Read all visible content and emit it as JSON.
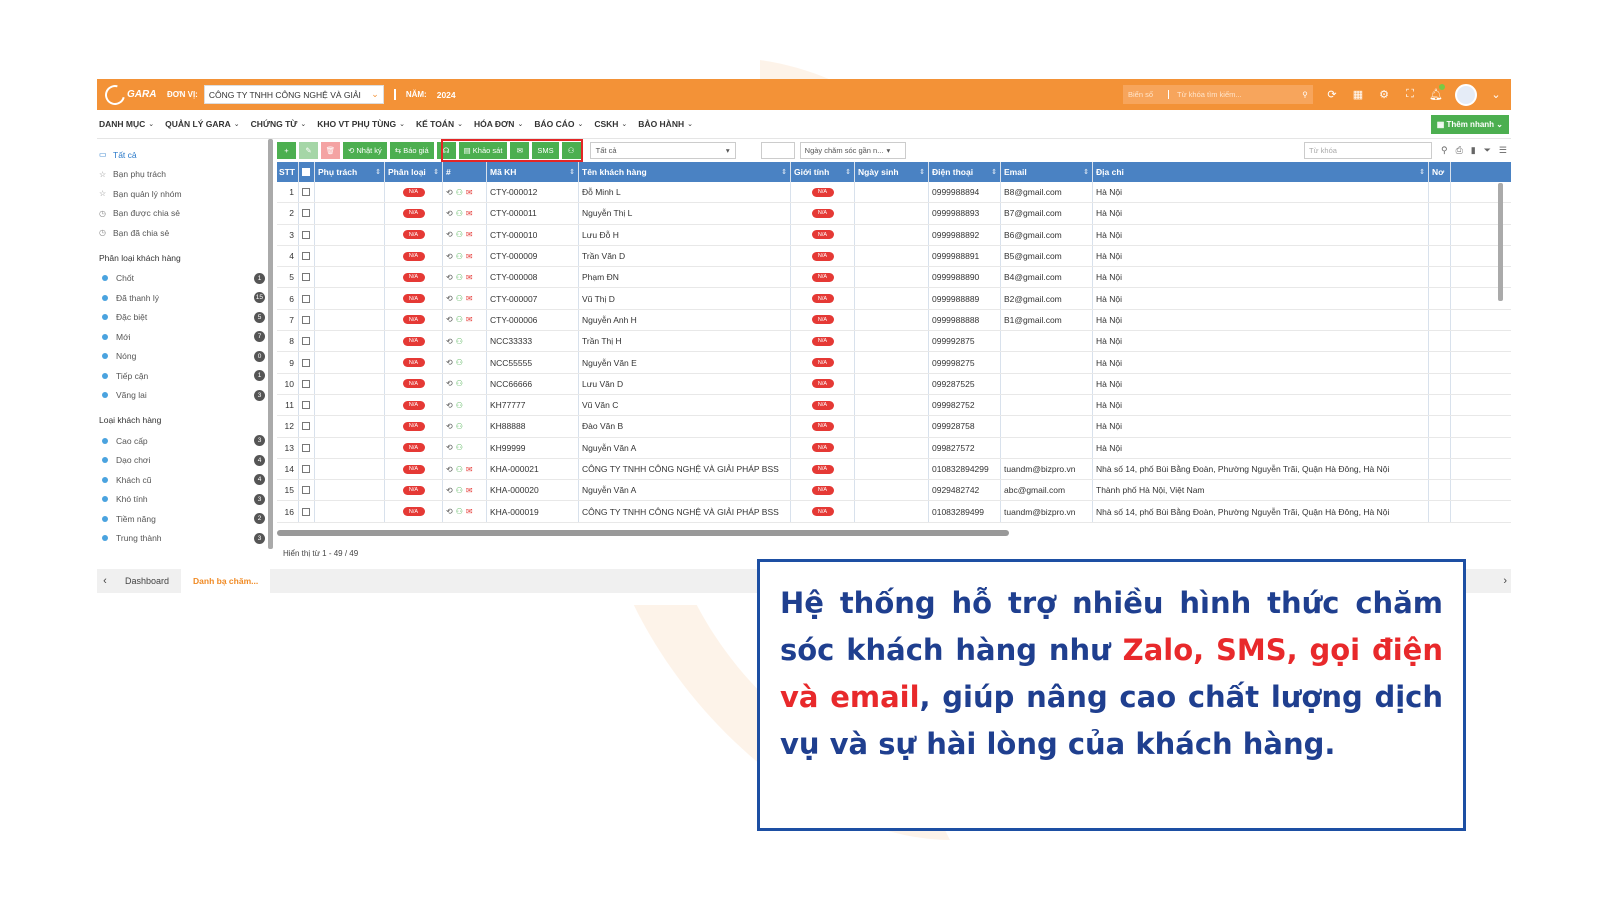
{
  "app": {
    "logo_text": "GARA",
    "unit_label": "ĐƠN VỊ:",
    "unit_value": "CÔNG TY TNHH CÔNG NGHỆ VÀ GIẢI",
    "year_label": "NĂM:",
    "year_value": "2024",
    "search_plate": "Biển số",
    "search_placeholder": "Từ khóa tìm kiếm...",
    "accent": "#f39237"
  },
  "menu": {
    "items": [
      "DANH MỤC",
      "QUẢN LÝ GARA",
      "CHỨNG TỪ",
      "KHO VT PHỤ TÙNG",
      "KẾ TOÁN",
      "HÓA ĐƠN",
      "BÁO CÁO",
      "CSKH",
      "BẢO HÀNH"
    ],
    "quick_add": "Thêm nhanh"
  },
  "sidebar": {
    "top": [
      {
        "label": "Tất cả",
        "icon": "inbox-icon"
      },
      {
        "label": "Bạn phụ trách",
        "icon": "star-icon"
      },
      {
        "label": "Bạn quản lý nhóm",
        "icon": "star-icon"
      },
      {
        "label": "Bạn được chia sẻ",
        "icon": "clock-icon"
      },
      {
        "label": "Bạn đã chia sẻ",
        "icon": "clock-icon"
      }
    ],
    "group1_title": "Phân loại khách hàng",
    "group1": [
      {
        "label": "Chốt",
        "count": "1"
      },
      {
        "label": "Đã thanh lý",
        "count": "15"
      },
      {
        "label": "Đặc biệt",
        "count": "5"
      },
      {
        "label": "Mới",
        "count": "7"
      },
      {
        "label": "Nóng",
        "count": "0"
      },
      {
        "label": "Tiếp cận",
        "count": "1"
      },
      {
        "label": "Vãng lai",
        "count": "3"
      }
    ],
    "group2_title": "Loại khách hàng",
    "group2": [
      {
        "label": "Cao cấp",
        "count": "3"
      },
      {
        "label": "Dạo chơi",
        "count": "4"
      },
      {
        "label": "Khách cũ",
        "count": "4"
      },
      {
        "label": "Khó tính",
        "count": "3"
      },
      {
        "label": "Tiềm năng",
        "count": "2"
      },
      {
        "label": "Trung thành",
        "count": "3"
      }
    ]
  },
  "toolbar": {
    "diary": "Nhật ký",
    "quote": "Báo giá",
    "survey": "Khảo sát",
    "sms": "SMS",
    "filter_all": "Tất cả",
    "date_filter": "Ngày chăm sóc gần n...",
    "keyword_placeholder": "Từ khóa"
  },
  "table": {
    "headers": [
      "STT",
      "Phụ trách",
      "Phân loại",
      "#",
      "Mã KH",
      "Tên khách hàng",
      "Giới tính",
      "Ngày sinh",
      "Điện thoại",
      "Email",
      "Địa chỉ",
      "Nơ"
    ],
    "na": "N/A",
    "rows": [
      {
        "stt": "1",
        "ma": "CTY-000012",
        "ten": "Đỗ Minh L",
        "dt": "0999988894",
        "email": "B8@gmail.com",
        "dc": "Hà Nội",
        "mail": true
      },
      {
        "stt": "2",
        "ma": "CTY-000011",
        "ten": "Nguyễn Thị L",
        "dt": "0999988893",
        "email": "B7@gmail.com",
        "dc": "Hà Nội",
        "mail": true
      },
      {
        "stt": "3",
        "ma": "CTY-000010",
        "ten": "Lưu Đỗ H",
        "dt": "0999988892",
        "email": "B6@gmail.com",
        "dc": "Hà Nội",
        "mail": true
      },
      {
        "stt": "4",
        "ma": "CTY-000009",
        "ten": "Trần Văn D",
        "dt": "0999988891",
        "email": "B5@gmail.com",
        "dc": "Hà Nội",
        "mail": true
      },
      {
        "stt": "5",
        "ma": "CTY-000008",
        "ten": "Phạm ĐN",
        "dt": "0999988890",
        "email": "B4@gmail.com",
        "dc": "Hà Nội",
        "mail": true
      },
      {
        "stt": "6",
        "ma": "CTY-000007",
        "ten": "Vũ Thị D",
        "dt": "0999988889",
        "email": "B2@gmail.com",
        "dc": "Hà Nội",
        "mail": true
      },
      {
        "stt": "7",
        "ma": "CTY-000006",
        "ten": "Nguyễn Anh H",
        "dt": "0999988888",
        "email": "B1@gmail.com",
        "dc": "Hà Nội",
        "mail": true
      },
      {
        "stt": "8",
        "ma": "NCC33333",
        "ten": "Trần Thị H",
        "dt": "099992875",
        "email": "",
        "dc": "Hà Nội",
        "mail": false
      },
      {
        "stt": "9",
        "ma": "NCC55555",
        "ten": "Nguyễn Văn E",
        "dt": "099998275",
        "email": "",
        "dc": "Hà Nội",
        "mail": false
      },
      {
        "stt": "10",
        "ma": "NCC66666",
        "ten": "Lưu Văn D",
        "dt": "099287525",
        "email": "",
        "dc": "Hà Nội",
        "mail": false
      },
      {
        "stt": "11",
        "ma": "KH77777",
        "ten": "Vũ Văn C",
        "dt": "099982752",
        "email": "",
        "dc": "Hà Nội",
        "mail": false
      },
      {
        "stt": "12",
        "ma": "KH88888",
        "ten": "Đào Văn B",
        "dt": "099928758",
        "email": "",
        "dc": "Hà Nội",
        "mail": false
      },
      {
        "stt": "13",
        "ma": "KH99999",
        "ten": "Nguyễn Văn A",
        "dt": "099827572",
        "email": "",
        "dc": "Hà Nội",
        "mail": false
      },
      {
        "stt": "14",
        "ma": "KHA-000021",
        "ten": "CÔNG TY TNHH CÔNG NGHỆ VÀ GIẢI PHÁP BSS",
        "dt": "010832894299",
        "email": "tuandm@bizpro.vn",
        "dc": "Nhà số 14, phố Bùi Bằng Đoàn, Phường Nguyễn Trãi, Quận Hà Đông, Hà Nội",
        "mail": true
      },
      {
        "stt": "15",
        "ma": "KHA-000020",
        "ten": "Nguyễn Văn A",
        "dt": "0929482742",
        "email": "abc@gmail.com",
        "dc": "Thành phố Hà Nội, Việt Nam",
        "mail": true
      },
      {
        "stt": "16",
        "ma": "KHA-000019",
        "ten": "CÔNG TY TNHH CÔNG NGHỆ VÀ GIẢI PHÁP BSS",
        "dt": "01083289499",
        "email": "tuandm@bizpro.vn",
        "dc": "Nhà số 14, phố Bùi Bằng Đoàn, Phường Nguyễn Trãi, Quận Hà Đông, Hà Nội",
        "mail": true
      }
    ],
    "footer": "Hiển thị từ 1 - 49 / 49"
  },
  "tabs": {
    "items": [
      "Dashboard",
      "Danh bạ chăm..."
    ]
  },
  "callout": {
    "part1": "Hệ thống hỗ trợ nhiều hình thức chăm sóc khách hàng như ",
    "highlight": "Zalo, SMS, gọi điện và email",
    "part2": ", giúp nâng cao chất lượng dịch vụ và sự hài lòng của khách hàng."
  }
}
